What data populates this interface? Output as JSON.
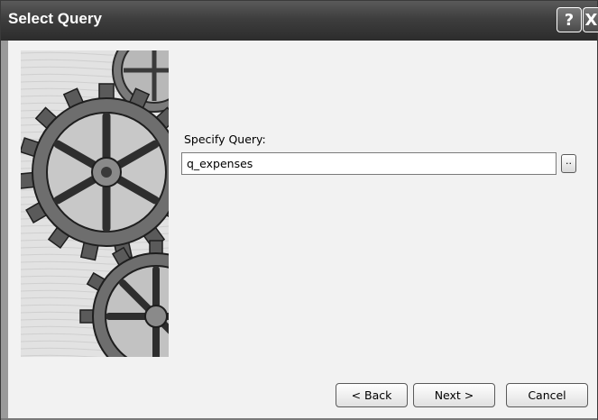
{
  "window": {
    "title": "Select Query",
    "help_label": "?",
    "close_label": "X"
  },
  "main": {
    "prompt": "Specify Query:",
    "query_value": "q_expenses",
    "browse_label": ".."
  },
  "footer": {
    "back_label": "< Back",
    "next_label": "Next >",
    "cancel_label": "Cancel"
  },
  "colors": {
    "titlebar": "#3e3e3e",
    "window_bg": "#f2f2f2"
  },
  "icons": {
    "wizard_art": "gears-illustration"
  }
}
